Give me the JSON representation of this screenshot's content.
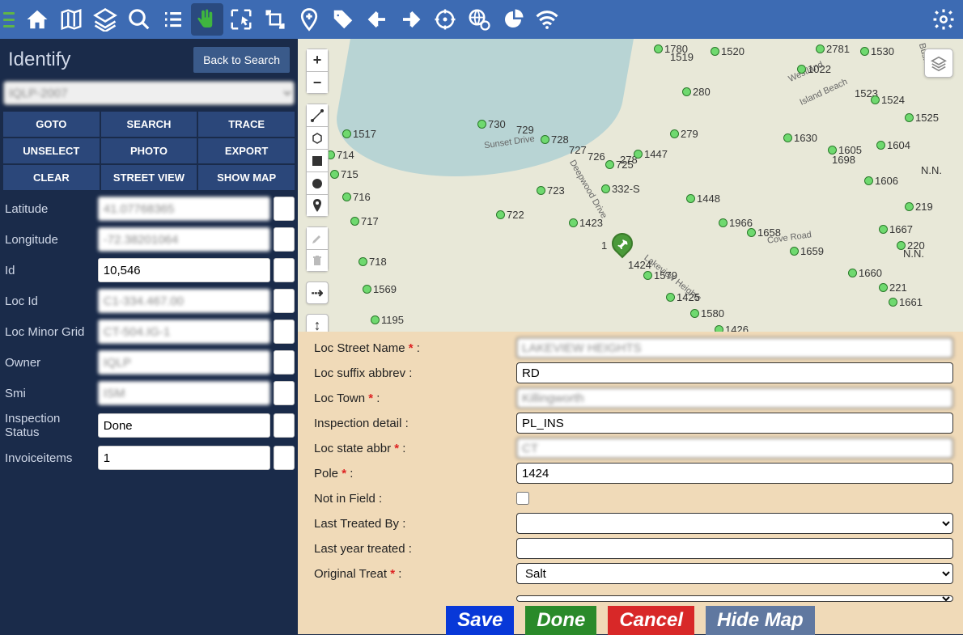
{
  "header": {
    "title": "Identify",
    "back": "Back to Search",
    "select_value": "IQLP-2007"
  },
  "btns": {
    "goto": "GOTO",
    "search": "SEARCH",
    "trace": "TRACE",
    "unselect": "UNSELECT",
    "photo": "PHOTO",
    "export": "EXPORT",
    "clear": "CLEAR",
    "streetview": "STREET VIEW",
    "showmap": "SHOW MAP"
  },
  "left": {
    "lat_l": "Latitude",
    "lat": "41.07768365",
    "lon_l": "Longitude",
    "lon": "-72.38201064",
    "id_l": "Id",
    "id": "10,546",
    "locid_l": "Loc Id",
    "locid": "C1-334.467.00",
    "grid_l": "Loc Minor Grid",
    "grid": "CT-504.IG-1",
    "owner_l": "Owner",
    "owner": "IQLP",
    "smi_l": "Smi",
    "smi": "ISM",
    "status_l": "Inspection Status",
    "status": "Done",
    "inv_l": "Invoiceitems",
    "inv": "1"
  },
  "detail": {
    "street_l": "Loc Street Name",
    "street": "LAKEVIEW HEIGHTS",
    "suffix_l": "Loc suffix abbrev :",
    "suffix": "RD",
    "town_l": "Loc Town",
    "town": "Killingworth",
    "insp_l": "Inspection detail :",
    "insp": "PL_INS",
    "state_l": "Loc state abbr",
    "state": "CT",
    "pole_l": "Pole",
    "pole": "1424",
    "nif_l": "Not in Field :",
    "lastby_l": "Last Treated By :",
    "lastyr_l": "Last year treated :",
    "orig_l": "Original Treat",
    "orig": "Salt"
  },
  "footer": {
    "save": "Save",
    "done": "Done",
    "cancel": "Cancel",
    "hidemap": "Hide Map"
  },
  "roads": {
    "sunset": "Sunset Drive",
    "deepwood": "Deepwood Drive",
    "cove": "Cove Road",
    "lakeview": "Lakeview Heights",
    "westland": "Westland",
    "beach": "Island Beach",
    "bush": "Bush Rd"
  }
}
